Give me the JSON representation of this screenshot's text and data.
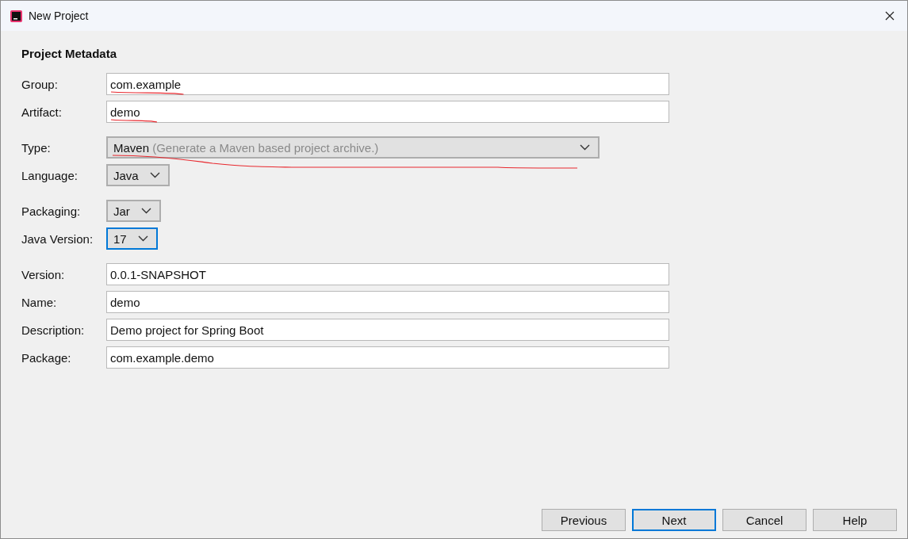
{
  "window": {
    "title": "New Project"
  },
  "section_title": "Project Metadata",
  "groups": [
    [
      {
        "kind": "text",
        "label": "Group:",
        "value": "com.example",
        "annotated": true,
        "focused": false
      },
      {
        "kind": "text",
        "label": "Artifact:",
        "value": "demo",
        "annotated": true,
        "focused": false
      }
    ],
    [
      {
        "kind": "select",
        "label": "Type:",
        "value": "Maven",
        "hint": "(Generate a Maven based project archive.)",
        "annotated": true,
        "focused": false
      },
      {
        "kind": "select",
        "label": "Language:",
        "value": "Java",
        "annotated": false,
        "focused": false
      }
    ],
    [
      {
        "kind": "select",
        "label": "Packaging:",
        "value": "Jar",
        "annotated": false,
        "focused": false
      },
      {
        "kind": "select",
        "label": "Java Version:",
        "value": "17",
        "annotated": false,
        "focused": true
      }
    ],
    [
      {
        "kind": "text",
        "label": "Version:",
        "value": "0.0.1-SNAPSHOT",
        "annotated": false,
        "focused": false
      },
      {
        "kind": "text",
        "label": "Name:",
        "value": "demo",
        "annotated": false,
        "focused": false
      },
      {
        "kind": "text",
        "label": "Description:",
        "value": "Demo project for Spring Boot",
        "annotated": false,
        "focused": false
      },
      {
        "kind": "text",
        "label": "Package:",
        "value": "com.example.demo",
        "annotated": false,
        "focused": false
      }
    ]
  ],
  "buttons": [
    {
      "label": "Previous",
      "default": false
    },
    {
      "label": "Next",
      "default": true
    },
    {
      "label": "Cancel",
      "default": false
    },
    {
      "label": "Help",
      "default": false
    }
  ]
}
